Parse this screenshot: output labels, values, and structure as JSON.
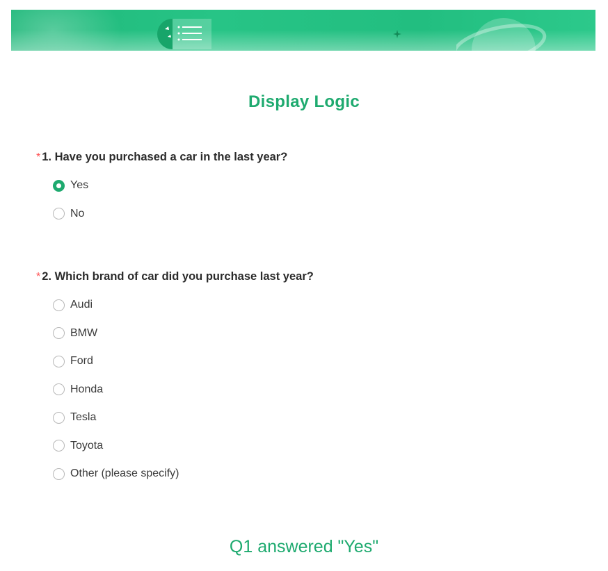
{
  "survey": {
    "title": "Display Logic",
    "questions": [
      {
        "required_mark": "*",
        "label": "1. Have you purchased a car in the last year?",
        "options": [
          "Yes",
          "No"
        ],
        "selected": "Yes"
      },
      {
        "required_mark": "*",
        "label": "2. Which brand of car did you purchase last year?",
        "options": [
          "Audi",
          "BMW",
          "Ford",
          "Honda",
          "Tesla",
          "Toyota",
          "Other (please specify)"
        ],
        "selected": null
      }
    ]
  },
  "caption": "Q1 answered \"Yes\"",
  "colors": {
    "accent": "#1eaa6f",
    "banner": "#22be80",
    "required": "#ff4d4f"
  },
  "icons": {
    "banner_logo": "survey-list-icon",
    "banner_star": "sparkle-icon",
    "banner_planet": "planet-icon"
  }
}
